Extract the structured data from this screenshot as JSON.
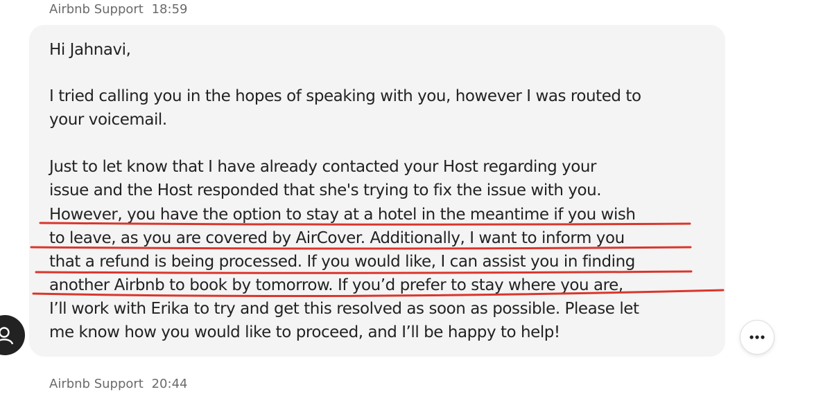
{
  "messages": [
    {
      "sender": "Airbnb Support",
      "time": "18:59",
      "lines": [
        "Hi Jahnavi,",
        "I tried calling you in the hopes of speaking with you, however I was routed to",
        "your voicemail.",
        "Just to let know that I have already contacted your Host regarding your",
        "issue and the Host responded that she's trying to fix the issue with you.",
        "However, you have the option to stay at a hotel in the meantime if you wish",
        "to leave, as you are covered by AirCover. Additionally, I want to inform you",
        "that a refund is being processed. If you would like, I can assist you in finding",
        "another Airbnb to book by tomorrow. If you’d prefer to stay where you are,",
        "I’ll work with Erika to try and get this resolved as soon as possible. Please let",
        "me know how you would like to proceed, and I’ll be happy to help!"
      ]
    },
    {
      "sender": "Airbnb Support",
      "time": "20:44"
    }
  ],
  "colors": {
    "bubble": "#f4f4f4",
    "text": "#222222",
    "meta": "#6a6a6a",
    "annotation_underline": "#d9362c",
    "avatar": "#222222"
  },
  "icons": {
    "avatar": "user-icon",
    "more": "more-horizontal-icon"
  }
}
